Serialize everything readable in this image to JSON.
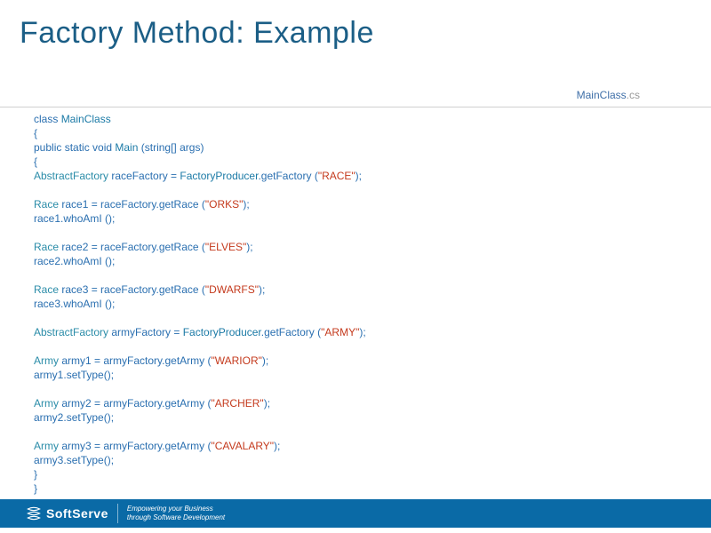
{
  "title": "Factory Method: Example",
  "filename": {
    "base": "MainClass",
    "ext": ".cs"
  },
  "code": {
    "lines": [
      [
        {
          "c": "kw",
          "t": "class "
        },
        {
          "c": "name",
          "t": "MainClass"
        }
      ],
      [
        {
          "c": "punct",
          "t": "{"
        }
      ],
      [
        {
          "c": "kw",
          "t": "public static void "
        },
        {
          "c": "name",
          "t": "Main "
        },
        {
          "c": "punct",
          "t": "("
        },
        {
          "c": "kw",
          "t": "string"
        },
        {
          "c": "punct",
          "t": "[] "
        },
        {
          "c": "plain",
          "t": "args"
        },
        {
          "c": "punct",
          "t": ")"
        }
      ],
      [
        {
          "c": "punct",
          "t": "{"
        }
      ],
      [
        {
          "c": "type",
          "t": "AbstractFactory "
        },
        {
          "c": "plain",
          "t": "raceFactory = "
        },
        {
          "c": "name",
          "t": "FactoryProducer"
        },
        {
          "c": "punct",
          "t": "."
        },
        {
          "c": "call",
          "t": "getFactory "
        },
        {
          "c": "punct",
          "t": "("
        },
        {
          "c": "str",
          "t": "\"RACE\""
        },
        {
          "c": "punct",
          "t": ");"
        }
      ],
      [
        {
          "c": "plain",
          "t": ""
        }
      ],
      [
        {
          "c": "type",
          "t": "Race "
        },
        {
          "c": "plain",
          "t": "race1 = raceFactory."
        },
        {
          "c": "call",
          "t": "getRace "
        },
        {
          "c": "punct",
          "t": "("
        },
        {
          "c": "str",
          "t": "\"ORKS\""
        },
        {
          "c": "punct",
          "t": ");"
        }
      ],
      [
        {
          "c": "plain",
          "t": "race1."
        },
        {
          "c": "call",
          "t": "whoAmI "
        },
        {
          "c": "punct",
          "t": "();"
        }
      ],
      [
        {
          "c": "plain",
          "t": ""
        }
      ],
      [
        {
          "c": "type",
          "t": "Race "
        },
        {
          "c": "plain",
          "t": "race2 = raceFactory."
        },
        {
          "c": "call",
          "t": "getRace "
        },
        {
          "c": "punct",
          "t": "("
        },
        {
          "c": "str",
          "t": "\"ELVES\""
        },
        {
          "c": "punct",
          "t": ");"
        }
      ],
      [
        {
          "c": "plain",
          "t": "race2."
        },
        {
          "c": "call",
          "t": "whoAmI "
        },
        {
          "c": "punct",
          "t": "();"
        }
      ],
      [
        {
          "c": "plain",
          "t": ""
        }
      ],
      [
        {
          "c": "type",
          "t": "Race "
        },
        {
          "c": "plain",
          "t": "race3 = raceFactory."
        },
        {
          "c": "call",
          "t": "getRace "
        },
        {
          "c": "punct",
          "t": "("
        },
        {
          "c": "str",
          "t": "\"DWARFS\""
        },
        {
          "c": "punct",
          "t": ");"
        }
      ],
      [
        {
          "c": "plain",
          "t": "race3."
        },
        {
          "c": "call",
          "t": "whoAmI "
        },
        {
          "c": "punct",
          "t": "();"
        }
      ],
      [
        {
          "c": "plain",
          "t": ""
        }
      ],
      [
        {
          "c": "type",
          "t": "AbstractFactory "
        },
        {
          "c": "plain",
          "t": "armyFactory = "
        },
        {
          "c": "name",
          "t": "FactoryProducer"
        },
        {
          "c": "punct",
          "t": "."
        },
        {
          "c": "call",
          "t": "getFactory "
        },
        {
          "c": "punct",
          "t": "("
        },
        {
          "c": "str",
          "t": "\"ARMY\""
        },
        {
          "c": "punct",
          "t": ");"
        }
      ],
      [
        {
          "c": "plain",
          "t": ""
        }
      ],
      [
        {
          "c": "type",
          "t": "Army "
        },
        {
          "c": "plain",
          "t": "army1 = armyFactory."
        },
        {
          "c": "call",
          "t": "getArmy "
        },
        {
          "c": "punct",
          "t": "("
        },
        {
          "c": "str",
          "t": "\"WARIOR\""
        },
        {
          "c": "punct",
          "t": ");"
        }
      ],
      [
        {
          "c": "plain",
          "t": "army1."
        },
        {
          "c": "call",
          "t": "setType"
        },
        {
          "c": "punct",
          "t": "();"
        }
      ],
      [
        {
          "c": "plain",
          "t": ""
        }
      ],
      [
        {
          "c": "type",
          "t": "Army "
        },
        {
          "c": "plain",
          "t": "army2 = armyFactory."
        },
        {
          "c": "call",
          "t": "getArmy "
        },
        {
          "c": "punct",
          "t": "("
        },
        {
          "c": "str",
          "t": "\"ARCHER\""
        },
        {
          "c": "punct",
          "t": ");"
        }
      ],
      [
        {
          "c": "plain",
          "t": "army2."
        },
        {
          "c": "call",
          "t": "setType"
        },
        {
          "c": "punct",
          "t": "();"
        }
      ],
      [
        {
          "c": "plain",
          "t": ""
        }
      ],
      [
        {
          "c": "type",
          "t": "Army "
        },
        {
          "c": "plain",
          "t": "army3 = armyFactory."
        },
        {
          "c": "call",
          "t": "getArmy "
        },
        {
          "c": "punct",
          "t": "("
        },
        {
          "c": "str",
          "t": "\"CAVALARY\""
        },
        {
          "c": "punct",
          "t": ");"
        }
      ],
      [
        {
          "c": "plain",
          "t": "army3."
        },
        {
          "c": "call",
          "t": "setType"
        },
        {
          "c": "punct",
          "t": "();"
        }
      ],
      [
        {
          "c": "punct",
          "t": "}"
        }
      ],
      [
        {
          "c": "punct",
          "t": "}"
        }
      ]
    ]
  },
  "footer": {
    "brand": "SoftServe",
    "tagline1": "Empowering your Business",
    "tagline2": "through Software Development"
  }
}
